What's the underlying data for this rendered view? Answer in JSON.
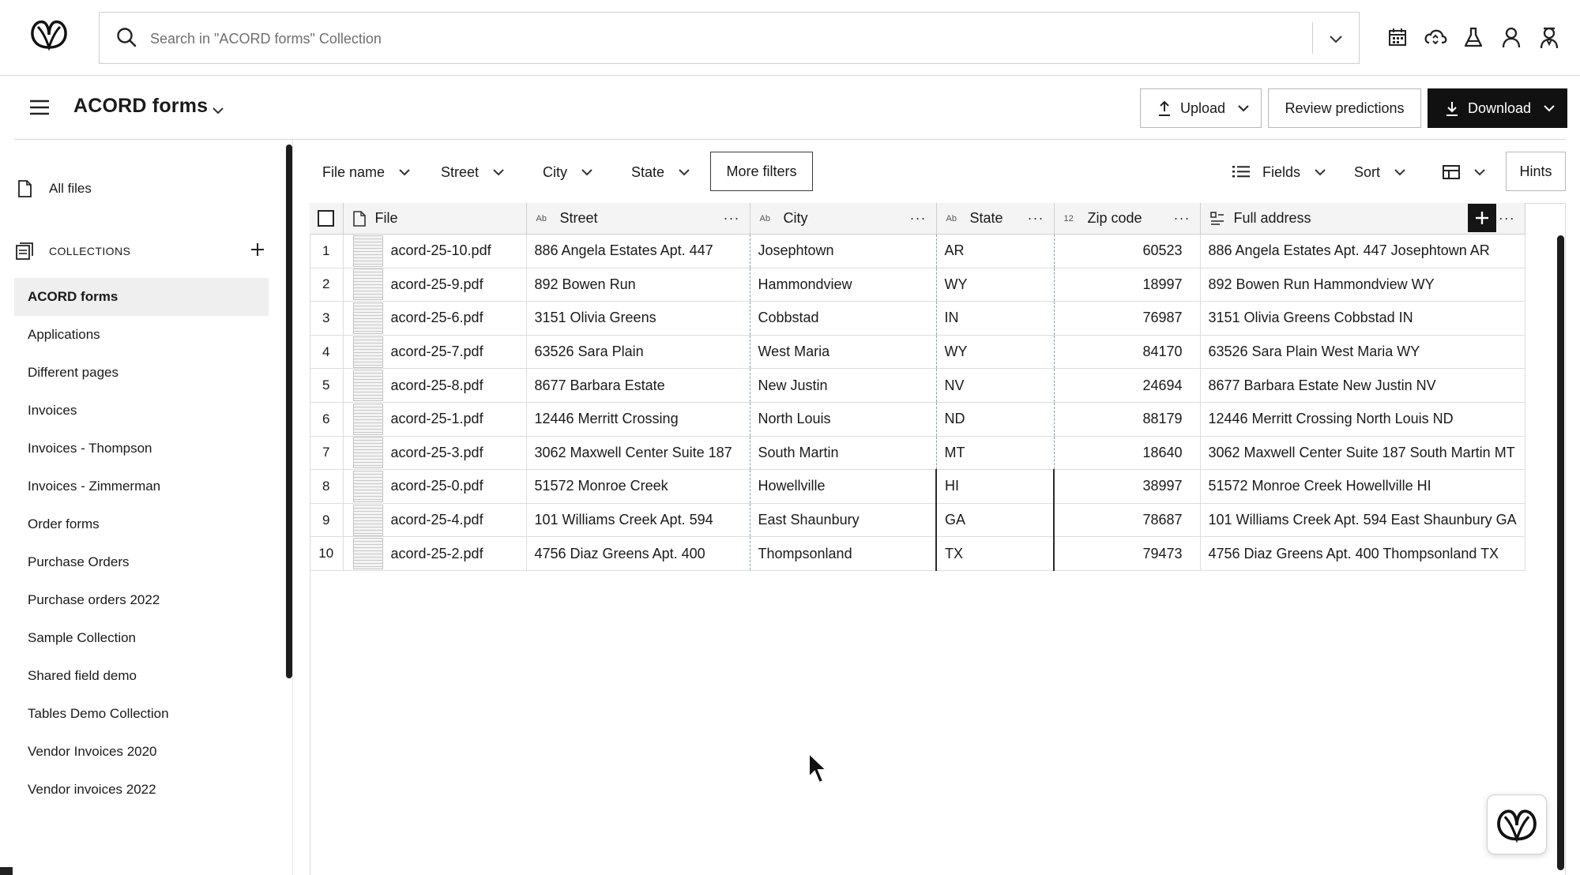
{
  "search": {
    "placeholder": "Search in \"ACORD forms\" Collection"
  },
  "top_icons": [
    "calendar-icon",
    "cloud-sync-icon",
    "flask-icon",
    "user-icon",
    "agent-icon"
  ],
  "header": {
    "title": "ACORD forms",
    "upload_label": "Upload",
    "review_label": "Review predictions",
    "download_label": "Download"
  },
  "sidebar": {
    "all_files": "All files",
    "collections_label": "COLLECTIONS",
    "items": [
      {
        "label": "ACORD forms",
        "active": true
      },
      {
        "label": "Applications"
      },
      {
        "label": "Different pages"
      },
      {
        "label": "Invoices"
      },
      {
        "label": "Invoices - Thompson"
      },
      {
        "label": "Invoices - Zimmerman"
      },
      {
        "label": "Order forms"
      },
      {
        "label": "Purchase Orders"
      },
      {
        "label": "Purchase orders 2022"
      },
      {
        "label": "Sample Collection"
      },
      {
        "label": "Shared field demo"
      },
      {
        "label": "Tables Demo Collection"
      },
      {
        "label": "Vendor Invoices 2020"
      },
      {
        "label": "Vendor invoices 2022"
      }
    ]
  },
  "filters": {
    "file_name": "File name",
    "street": "Street",
    "city": "City",
    "state": "State",
    "more": "More filters",
    "fields": "Fields",
    "sort": "Sort",
    "hints": "Hints"
  },
  "table": {
    "columns": [
      {
        "label": "File",
        "type": ""
      },
      {
        "label": "Street",
        "type": "Ab"
      },
      {
        "label": "City",
        "type": "Ab"
      },
      {
        "label": "State",
        "type": "Ab"
      },
      {
        "label": "Zip code",
        "type": "12"
      },
      {
        "label": "Full address",
        "type": ""
      }
    ],
    "rows": [
      {
        "n": "1",
        "file": "acord-25-10.pdf",
        "street": "886 Angela Estates Apt. 447",
        "city": "Josephtown",
        "state": "AR",
        "zip": "60523",
        "full": "886 Angela Estates Apt. 447 Josephtown AR"
      },
      {
        "n": "2",
        "file": "acord-25-9.pdf",
        "street": "892 Bowen Run",
        "city": "Hammondview",
        "state": "WY",
        "zip": "18997",
        "full": "892 Bowen Run Hammondview WY"
      },
      {
        "n": "3",
        "file": "acord-25-6.pdf",
        "street": "3151 Olivia Greens",
        "city": "Cobbstad",
        "state": "IN",
        "zip": "76987",
        "full": "3151 Olivia Greens Cobbstad IN"
      },
      {
        "n": "4",
        "file": "acord-25-7.pdf",
        "street": "63526 Sara Plain",
        "city": "West Maria",
        "state": "WY",
        "zip": "84170",
        "full": "63526 Sara Plain West Maria WY"
      },
      {
        "n": "5",
        "file": "acord-25-8.pdf",
        "street": "8677 Barbara Estate",
        "city": "New Justin",
        "state": "NV",
        "zip": "24694",
        "full": "8677 Barbara Estate New Justin NV"
      },
      {
        "n": "6",
        "file": "acord-25-1.pdf",
        "street": "12446 Merritt Crossing",
        "city": "North Louis",
        "state": "ND",
        "zip": "88179",
        "full": "12446 Merritt Crossing North Louis ND"
      },
      {
        "n": "7",
        "file": "acord-25-3.pdf",
        "street": "3062 Maxwell Center Suite 187",
        "city": "South Martin",
        "state": "MT",
        "zip": "18640",
        "full": "3062 Maxwell Center Suite 187 South Martin MT"
      },
      {
        "n": "8",
        "file": "acord-25-0.pdf",
        "street": "51572 Monroe Creek",
        "city": "Howellville",
        "state": "HI",
        "zip": "38997",
        "full": "51572 Monroe Creek Howellville HI"
      },
      {
        "n": "9",
        "file": "acord-25-4.pdf",
        "street": "101 Williams Creek Apt. 594",
        "city": "East Shaunbury",
        "state": "GA",
        "zip": "78687",
        "full": "101 Williams Creek Apt. 594 East Shaunbury GA"
      },
      {
        "n": "10",
        "file": "acord-25-2.pdf",
        "street": "4756 Diaz Greens Apt. 400",
        "city": "Thompsonland",
        "state": "TX",
        "zip": "79473",
        "full": "4756 Diaz Greens Apt. 400 Thompsonland TX"
      }
    ]
  }
}
